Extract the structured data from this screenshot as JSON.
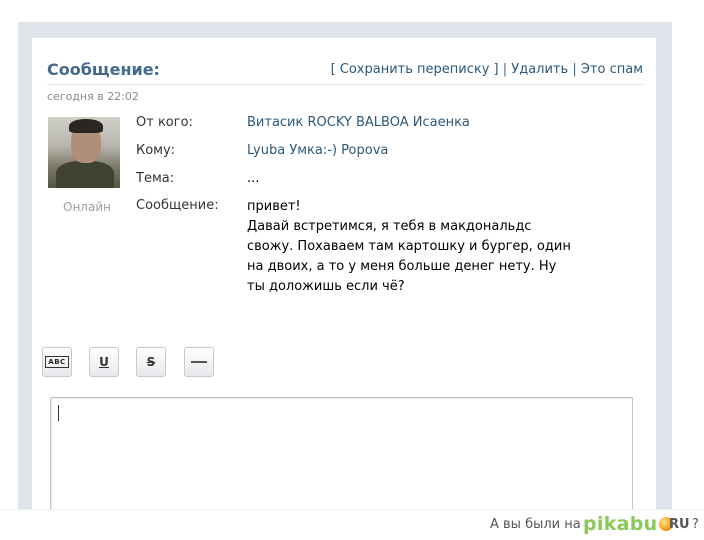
{
  "header": {
    "title": "Сообщение:",
    "save_label": "[ Сохранить переписку ]",
    "separator": "|",
    "delete_label": "Удалить",
    "spam_label": "Это спам"
  },
  "date": "сегодня в 22:02",
  "sender": {
    "status": "Онлайн"
  },
  "fields": {
    "from_label": "От кого:",
    "from_value": "Витасик ROCKY BALBOA Исаенка",
    "to_label": "Кому:",
    "to_value": "Lyuba Умка:-) Popova",
    "subject_label": "Тема:",
    "subject_value": "...",
    "message_label": "Сообщение:"
  },
  "message_lines": [
    "привет!",
    "Давай встретимся, я тебя в макдональдс",
    "свожу. Похаваем там картошку и бургер, один",
    "на двоих, а то у меня больше денег нету. Ну",
    "ты доложишь если чё?"
  ],
  "toolbar": {
    "abc_label": "ABC",
    "underline_label": "U",
    "strike_label": "S"
  },
  "footer": {
    "text": "А вы были на",
    "logo_text": "pikabu",
    "logo_suffix": "RU",
    "question": "?"
  },
  "colors": {
    "brand": "#45688e",
    "link": "#2b587a",
    "pikabu_green": "#8ac858"
  }
}
